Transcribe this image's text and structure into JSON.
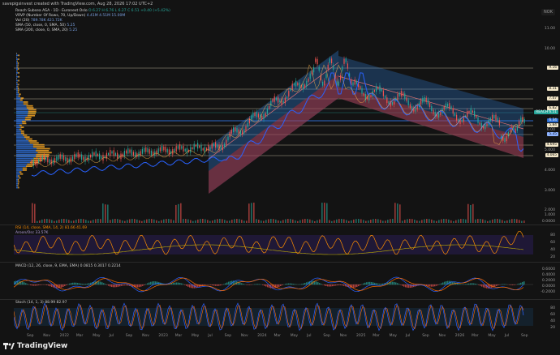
{
  "header": {
    "created": "savepigsinvest created with TradingView.com, Aug 28, 2026 17:02 UTC+2",
    "currency": "NOK"
  },
  "legends": {
    "main": [
      {
        "text": "Reach Subsea ASA · 1D · Euronext Oslo",
        "tail": "O 6.27  H 6.76  L 6.27  C 6.51  +0.40 (+5.42%)"
      },
      {
        "text": "VRVP (Number Of Rows, 70, Up/Down)",
        "tail": "4.41M  4.51M  15.00M"
      },
      {
        "text": "Vol (20)",
        "tail": "789.78K  421.72K"
      },
      {
        "text": "SMA (50, close, 0, SMA, 50)",
        "tail": "5.25"
      },
      {
        "text": "SMA (200, close, 0, SMA, 20)",
        "tail": "5.25"
      }
    ],
    "rsi": "RSI (14, close, SMA, 14, 2)  81.66  41.69",
    "rsi_sub": "Aroon/Osc  33.57K",
    "macd": "MACD (12, 26, close, 9, EMA, EMA)  0.0815  0.3017  0.2214",
    "stoch": "Stoch (14, 1, 3)  88.99  82.97"
  },
  "price_scale": [
    "11.00",
    "10.00",
    "9.00",
    "8.00",
    "7.00",
    "6.00",
    "5.000",
    "4.000",
    "3.000",
    "2.000",
    "1.000",
    "0.0000"
  ],
  "price_tags": [
    {
      "label": "9.16",
      "color": "#f2e6c8"
    },
    {
      "label": "8.31",
      "color": "#f2e6c8"
    },
    {
      "label": "7.47",
      "color": "#f2e6c8"
    },
    {
      "label": "6.82",
      "color": "#f2e6c8"
    },
    {
      "label": "REACH 6.51",
      "color": "#26a69a"
    },
    {
      "label": "6.34",
      "color": "#2f6fd3"
    },
    {
      "label": "5.84",
      "color": "#f2e6c8"
    },
    {
      "label": "5.35",
      "color": "#8fb3ff"
    },
    {
      "label": "4.695",
      "color": "#f2e6c8"
    },
    {
      "label": "4.065",
      "color": "#f2e6c8"
    }
  ],
  "rsi_scale": [
    "80",
    "60",
    "40",
    "20"
  ],
  "macd_scale": [
    "0.6000",
    "0.4000",
    "0.2000",
    "0.0000",
    "-0.2000"
  ],
  "stoch_scale": [
    "80",
    "60",
    "40",
    "20"
  ],
  "x_labels": [
    "Sep",
    "Nov",
    "2022",
    "Mar",
    "May",
    "Jul",
    "Sep",
    "Nov",
    "2023",
    "Mar",
    "May",
    "Jul",
    "Sep",
    "Nov",
    "2024",
    "Mar",
    "May",
    "Jul",
    "Sep",
    "Nov",
    "2025",
    "Mar",
    "May",
    "Jul",
    "Sep",
    "Nov",
    "2026",
    "Mar",
    "May",
    "Jul",
    "Sep"
  ],
  "brand": "TradingView",
  "colors": {
    "bull": "#26a69a",
    "bear": "#ef5350",
    "sma50": "#2962ff",
    "sma200": "#ffb74d",
    "channel_blue": "#2f7fd8",
    "channel_red": "#c62828",
    "rsi": "#ff8f00",
    "macd": "#2962ff",
    "signal": "#ff6d00",
    "stoch_k": "#2962ff",
    "stoch_d": "#ff6d00"
  }
}
